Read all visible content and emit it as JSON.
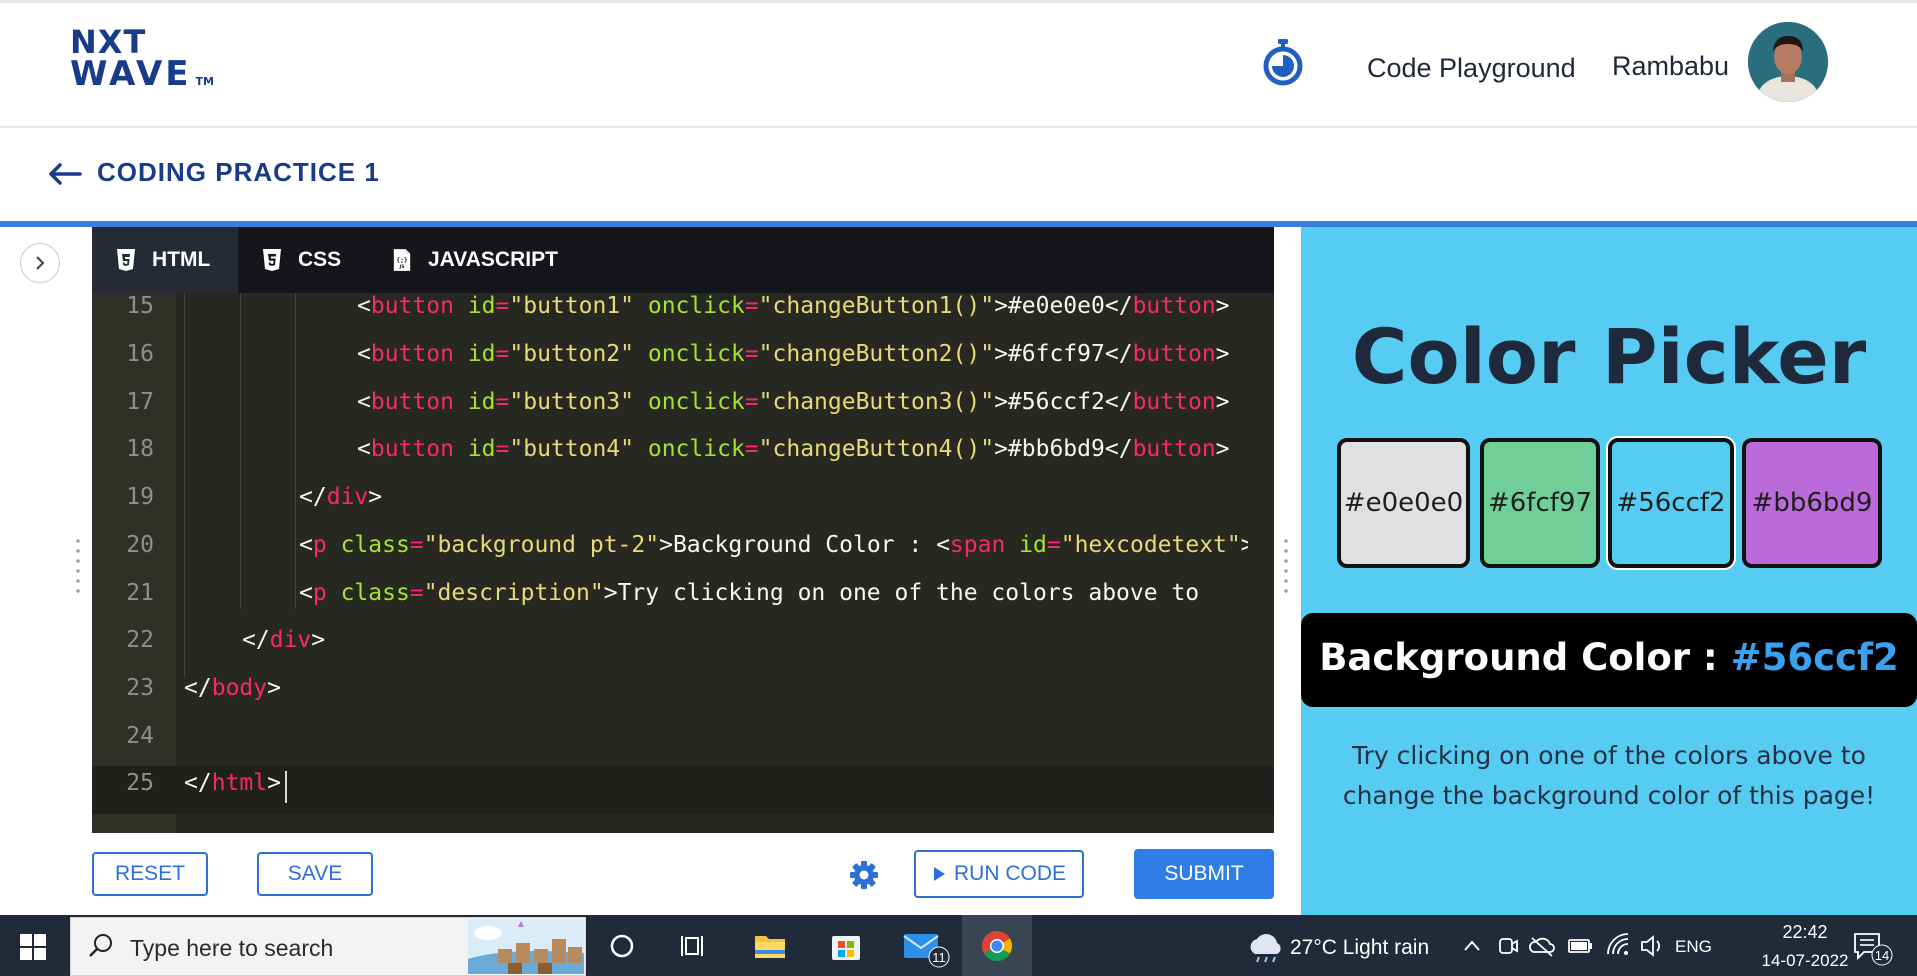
{
  "header": {
    "logo_line1": "NXT",
    "logo_line2": "WAVE",
    "logo_tm": "TM",
    "nav_playground": "Code Playground",
    "user_name": "Rambabu"
  },
  "subheader": {
    "title": "CODING PRACTICE 1"
  },
  "editor": {
    "tabs": [
      {
        "label": "HTML",
        "icon": "html5-icon",
        "active": true
      },
      {
        "label": "CSS",
        "icon": "css3-icon",
        "active": false
      },
      {
        "label": "JAVASCRIPT",
        "icon": "js-file-icon",
        "active": false
      }
    ],
    "line_numbers": [
      "15",
      "16",
      "17",
      "18",
      "19",
      "20",
      "21",
      "22",
      "23",
      "24",
      "25"
    ],
    "code_lines": [
      "<button id=\"button1\" onclick=\"changeButton1()\">#e0e0e0</button>",
      "<button id=\"button2\" onclick=\"changeButton2()\">#6fcf97</button>",
      "<button id=\"button3\" onclick=\"changeButton3()\">#56ccf2</button>",
      "<button id=\"button4\" onclick=\"changeButton4()\">#bb6bd9</button>",
      "</div>",
      "<p class=\"background pt-2\">Background Color : <span id=\"hexcodetext\">",
      "<p class=\"description\">Try clicking on one of the colors above to",
      "</div>",
      "</body>",
      "",
      "</html>"
    ]
  },
  "actions": {
    "reset": "RESET",
    "save": "SAVE",
    "run": "RUN CODE",
    "submit": "SUBMIT"
  },
  "output": {
    "heading": "Color Picker",
    "color_buttons": [
      {
        "label": "#e0e0e0",
        "color": "#e0e0e0"
      },
      {
        "label": "#6fcf97",
        "color": "#6fcf97"
      },
      {
        "label": "#56ccf2",
        "color": "#56ccf2"
      },
      {
        "label": "#bb6bd9",
        "color": "#bb6bd9"
      }
    ],
    "background_label": "Background Color : ",
    "background_hex": "#56ccf2",
    "description": "Try clicking on one of the colors above to change the background color of this page!",
    "page_background": "#56ccf2"
  },
  "taskbar": {
    "search_placeholder": "Type here to search",
    "mail_badge": "11",
    "weather": "27°C  Light rain",
    "language": "ENG",
    "time": "22:42",
    "date": "14-07-2022",
    "notification_badge": "14"
  },
  "colors": {
    "brand_blue": "#183b8a",
    "accent_blue": "#2f7de6",
    "editor_bg": "#272822",
    "taskbar_bg": "#202a38"
  }
}
